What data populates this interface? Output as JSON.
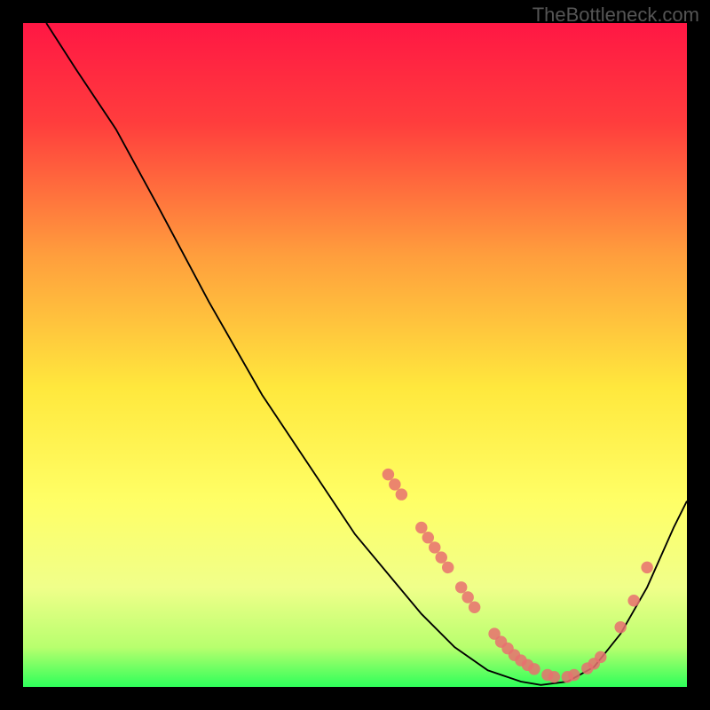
{
  "watermark": "TheBottleneck.com",
  "chart_data": {
    "type": "line",
    "title": "",
    "xlabel": "",
    "ylabel": "",
    "xlim": [
      0,
      100
    ],
    "ylim": [
      0,
      100
    ],
    "gradient_stops": [
      {
        "offset": 0,
        "color": "#ff1744"
      },
      {
        "offset": 15,
        "color": "#ff3d3d"
      },
      {
        "offset": 35,
        "color": "#ff9e3d"
      },
      {
        "offset": 55,
        "color": "#ffe83d"
      },
      {
        "offset": 72,
        "color": "#ffff66"
      },
      {
        "offset": 85,
        "color": "#f0ff8a"
      },
      {
        "offset": 94,
        "color": "#b8ff6e"
      },
      {
        "offset": 100,
        "color": "#2eff5a"
      }
    ],
    "curve_points": [
      {
        "x": 3.5,
        "y": 100
      },
      {
        "x": 8,
        "y": 93
      },
      {
        "x": 14,
        "y": 84
      },
      {
        "x": 20,
        "y": 73
      },
      {
        "x": 28,
        "y": 58
      },
      {
        "x": 36,
        "y": 44
      },
      {
        "x": 44,
        "y": 32
      },
      {
        "x": 50,
        "y": 23
      },
      {
        "x": 55,
        "y": 17
      },
      {
        "x": 60,
        "y": 11
      },
      {
        "x": 65,
        "y": 6
      },
      {
        "x": 70,
        "y": 2.5
      },
      {
        "x": 75,
        "y": 0.8
      },
      {
        "x": 78,
        "y": 0.3
      },
      {
        "x": 82,
        "y": 0.8
      },
      {
        "x": 86,
        "y": 3
      },
      {
        "x": 90,
        "y": 8
      },
      {
        "x": 94,
        "y": 15
      },
      {
        "x": 98,
        "y": 24
      },
      {
        "x": 100,
        "y": 28
      }
    ],
    "markers": [
      {
        "x": 55,
        "y": 32
      },
      {
        "x": 56,
        "y": 30.5
      },
      {
        "x": 57,
        "y": 29
      },
      {
        "x": 60,
        "y": 24
      },
      {
        "x": 61,
        "y": 22.5
      },
      {
        "x": 62,
        "y": 21
      },
      {
        "x": 63,
        "y": 19.5
      },
      {
        "x": 64,
        "y": 18
      },
      {
        "x": 66,
        "y": 15
      },
      {
        "x": 67,
        "y": 13.5
      },
      {
        "x": 68,
        "y": 12
      },
      {
        "x": 71,
        "y": 8
      },
      {
        "x": 72,
        "y": 6.8
      },
      {
        "x": 73,
        "y": 5.8
      },
      {
        "x": 74,
        "y": 4.8
      },
      {
        "x": 75,
        "y": 4
      },
      {
        "x": 76,
        "y": 3.3
      },
      {
        "x": 77,
        "y": 2.7
      },
      {
        "x": 79,
        "y": 1.8
      },
      {
        "x": 80,
        "y": 1.5
      },
      {
        "x": 82,
        "y": 1.5
      },
      {
        "x": 83,
        "y": 1.8
      },
      {
        "x": 85,
        "y": 2.8
      },
      {
        "x": 86,
        "y": 3.5
      },
      {
        "x": 87,
        "y": 4.5
      },
      {
        "x": 90,
        "y": 9
      },
      {
        "x": 92,
        "y": 13
      },
      {
        "x": 94,
        "y": 18
      }
    ],
    "marker_color": "#e87070",
    "curve_color": "#000000"
  }
}
